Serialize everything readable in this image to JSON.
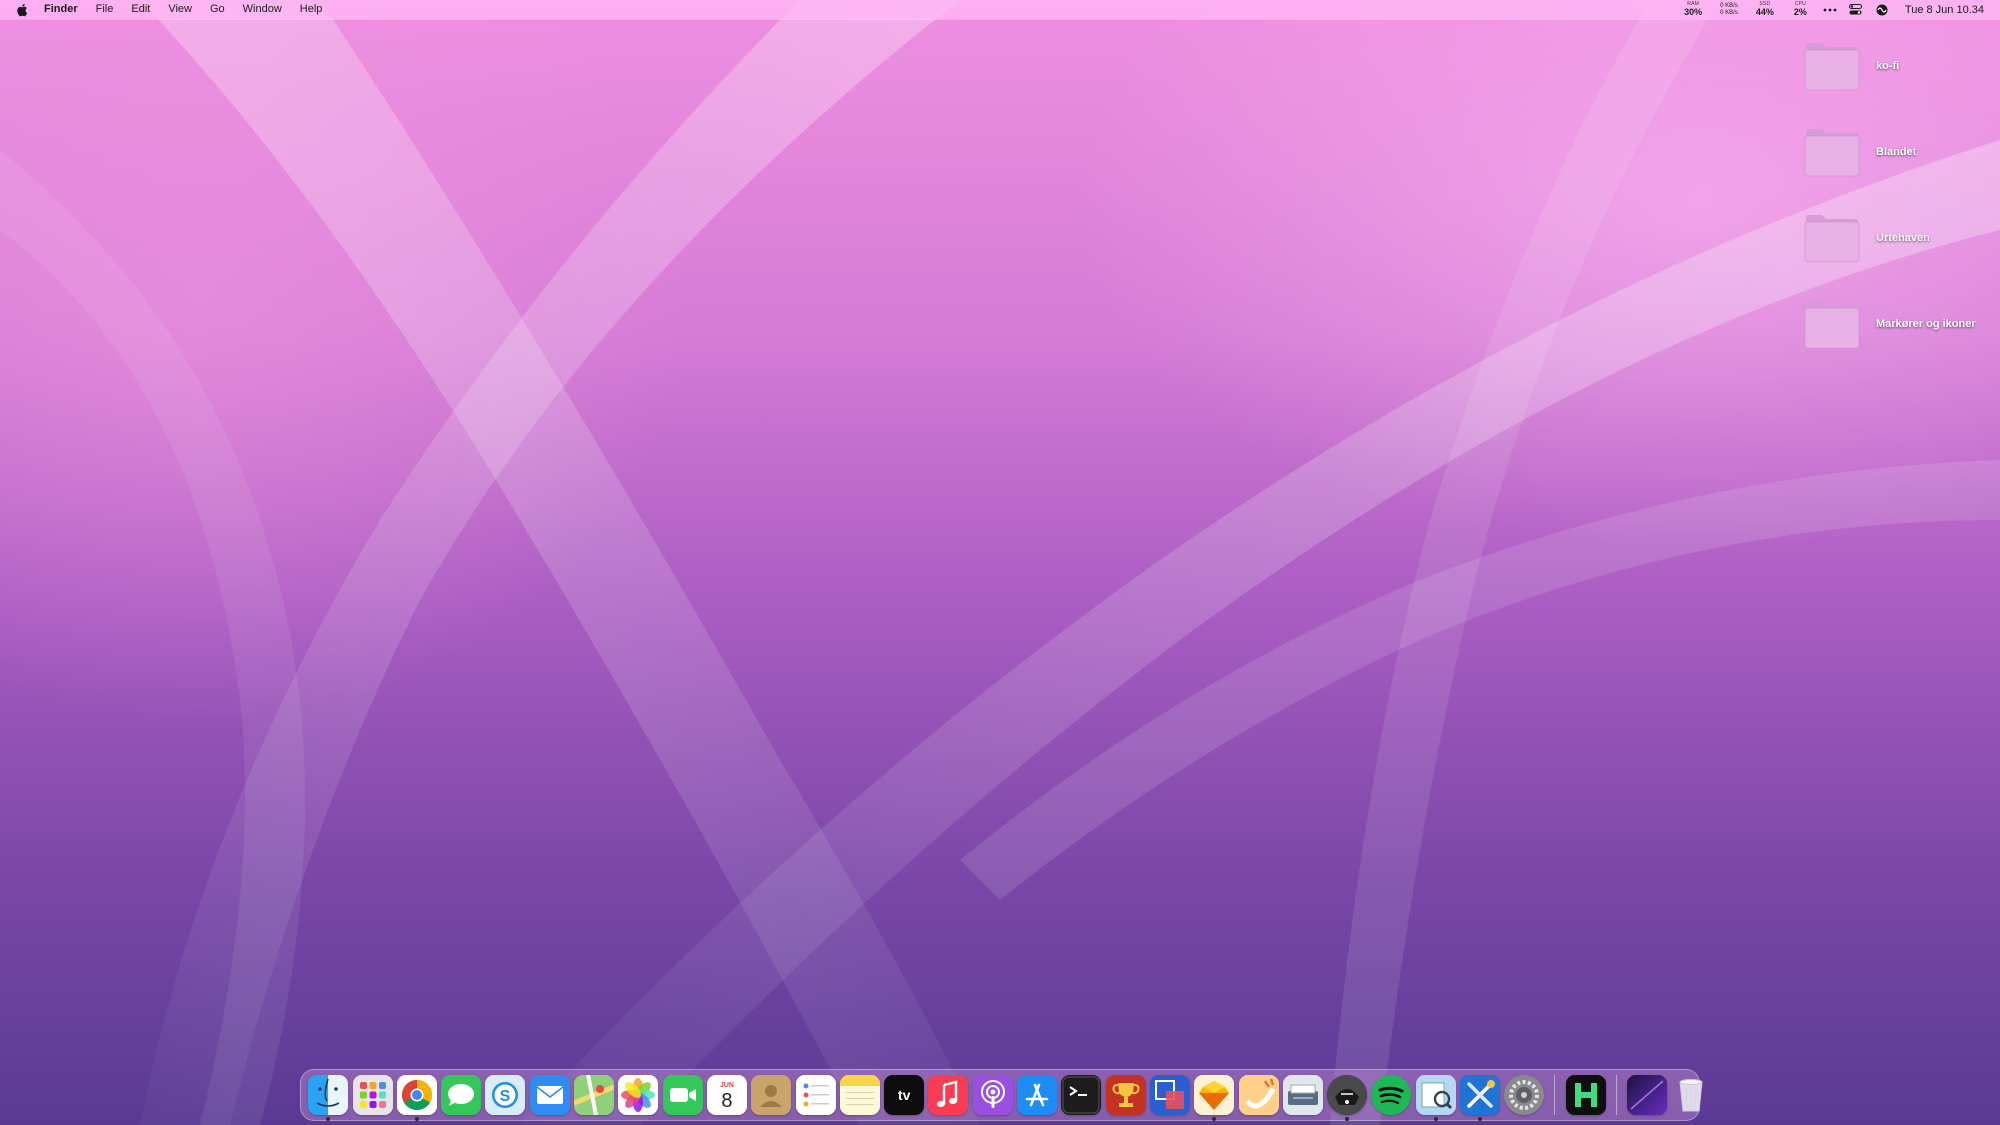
{
  "menubar": {
    "app_name": "Finder",
    "menus": [
      "File",
      "Edit",
      "View",
      "Go",
      "Window",
      "Help"
    ],
    "ram": {
      "label": "RAM",
      "value": "30%"
    },
    "network": {
      "up": "0 KB/s",
      "down": "0 KB/s"
    },
    "ssd": {
      "label": "SSD",
      "value": "44%"
    },
    "cpu": {
      "label": "CPU",
      "value": "2%"
    },
    "clock": "Tue 8 Jun  10.34"
  },
  "desktop_items": [
    {
      "label": "ko-fi"
    },
    {
      "label": "Blandet"
    },
    {
      "label": "Urtehaven"
    },
    {
      "label": "Markører og ikoner"
    }
  ],
  "dock": {
    "apps": [
      {
        "id": "finder",
        "running": true,
        "bg": "#2aa3f5"
      },
      {
        "id": "launchpad",
        "running": false,
        "bg": "#e6e6ea"
      },
      {
        "id": "chrome",
        "running": true,
        "bg": "#ffffff"
      },
      {
        "id": "messages",
        "running": false,
        "bg": "#34c759"
      },
      {
        "id": "skype",
        "running": false,
        "bg": "#d9ecfb"
      },
      {
        "id": "mail",
        "running": false,
        "bg": "#2f8cf0"
      },
      {
        "id": "maps",
        "running": false,
        "bg": "#8fd07a"
      },
      {
        "id": "photos",
        "running": false,
        "bg": "#ffffff"
      },
      {
        "id": "facetime",
        "running": false,
        "bg": "#34c759"
      },
      {
        "id": "calendar",
        "running": false,
        "bg": "#ffffff",
        "month": "JUN",
        "day": "8"
      },
      {
        "id": "contacts",
        "running": false,
        "bg": "#c9a56b"
      },
      {
        "id": "reminders",
        "running": false,
        "bg": "#ffffff"
      },
      {
        "id": "notes",
        "running": false,
        "bg": "#fff6c8"
      },
      {
        "id": "apple-tv",
        "running": false,
        "bg": "#0d0d0d",
        "text": "tv"
      },
      {
        "id": "music",
        "running": false,
        "bg": "#fa3c55"
      },
      {
        "id": "podcasts",
        "running": false,
        "bg": "#9b4fe0"
      },
      {
        "id": "app-store",
        "running": false,
        "bg": "#1e8cf5"
      },
      {
        "id": "terminal",
        "running": false,
        "bg": "#1d1d1d"
      },
      {
        "id": "trophy-app",
        "running": false,
        "bg": "#c43222"
      },
      {
        "id": "resizer-app",
        "running": false,
        "bg": "#2a5fd3"
      },
      {
        "id": "sketch",
        "running": true,
        "bg": "#fdf1d4"
      },
      {
        "id": "plug-app",
        "running": false,
        "bg": "#ffd089"
      },
      {
        "id": "scanner-app",
        "running": false,
        "bg": "#dfe6ee"
      },
      {
        "id": "alfred",
        "running": true,
        "bg": "#222222"
      },
      {
        "id": "spotify",
        "running": false,
        "bg": "#1db954"
      },
      {
        "id": "preview",
        "running": true,
        "bg": "#b6d7f3"
      },
      {
        "id": "xcode-tools",
        "running": true,
        "bg": "#1f74d6"
      },
      {
        "id": "system-preferences",
        "running": false,
        "bg": "#8a8a8e"
      },
      {
        "id": "hyper-app",
        "running": false,
        "bg": "#0f0f0f"
      },
      {
        "id": "downloads-stack",
        "running": false,
        "bg": "#2b1b55"
      },
      {
        "id": "trash",
        "running": false,
        "bg": "transparent"
      }
    ]
  }
}
